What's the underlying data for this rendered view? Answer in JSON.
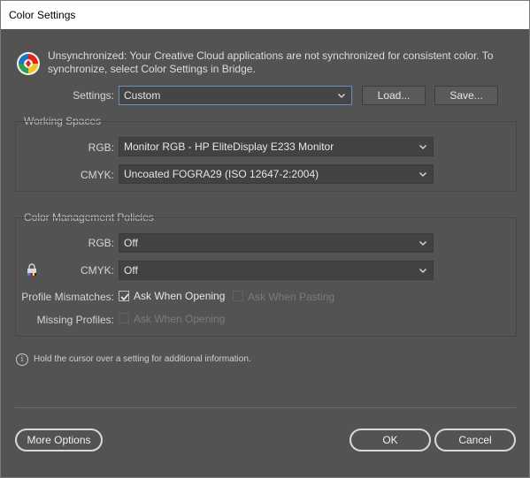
{
  "window": {
    "title": "Color Settings"
  },
  "sync": {
    "icon": "color-sync-icon",
    "message": "Unsynchronized: Your Creative Cloud applications are not synchronized for consistent color. To synchronize, select Color Settings in Bridge."
  },
  "settings": {
    "label": "Settings:",
    "value": "Custom",
    "load_label": "Load...",
    "save_label": "Save..."
  },
  "working_spaces": {
    "title": "Working Spaces",
    "rgb_label": "RGB:",
    "rgb_value": "Monitor RGB - HP EliteDisplay E233 Monitor",
    "cmyk_label": "CMYK:",
    "cmyk_value": "Uncoated FOGRA29 (ISO 12647-2:2004)"
  },
  "policies": {
    "title": "Color Management Policies",
    "rgb_label": "RGB:",
    "rgb_value": "Off",
    "cmyk_label": "CMYK:",
    "cmyk_value": "Off",
    "mismatch_label": "Profile Mismatches:",
    "ask_opening_label": "Ask When Opening",
    "ask_opening_checked": true,
    "ask_pasting_label": "Ask When Pasting",
    "ask_pasting_checked": false,
    "missing_label": "Missing Profiles:",
    "missing_ask_opening_label": "Ask When Opening",
    "missing_ask_opening_checked": false
  },
  "info": {
    "icon": "info-icon",
    "text": "Hold the cursor over a setting for additional information."
  },
  "footer": {
    "more_options_label": "More Options",
    "ok_label": "OK",
    "cancel_label": "Cancel"
  },
  "colors": {
    "dialog_bg": "#535353",
    "field_bg": "#424242",
    "focus_border": "#6a8fc3",
    "text": "#d4d4d4",
    "disabled_text": "#7b7b7b"
  }
}
